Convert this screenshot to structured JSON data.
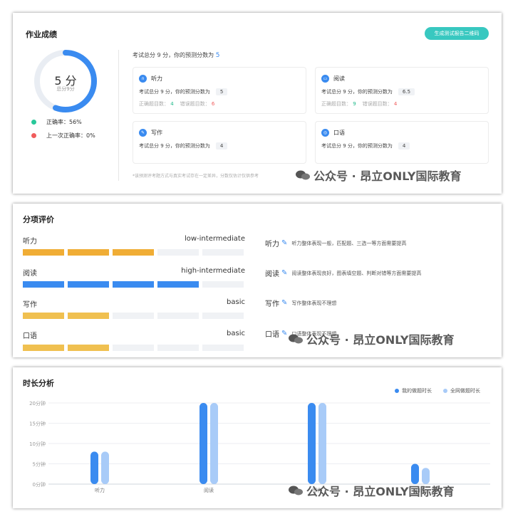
{
  "homework": {
    "title": "作业成绩",
    "generate_button": "生成测试报告二维码",
    "score_main": "5 分",
    "score_sub": "总分9分",
    "score_fraction": 0.556,
    "legend": [
      {
        "label": "正确率：",
        "value": "56%",
        "color": "#28c89a"
      },
      {
        "label": "上一次正确率：",
        "value": "0%",
        "color": "#f05c5c"
      }
    ],
    "summary_text": "考试总分 9 分，你的预测分数为",
    "summary_value": "5",
    "skills": [
      {
        "name": "听力",
        "icon": "headphones-icon",
        "glyph": "∩",
        "line": "考试总分 9 分，你的预测分数为",
        "score": "5",
        "correct_label": "正确题目数：",
        "correct": "4",
        "wrong_label": "错误题目数：",
        "wrong": "6"
      },
      {
        "name": "阅读",
        "icon": "book-icon",
        "glyph": "▭",
        "line": "考试总分 9 分，你的预测分数为",
        "score": "6.5",
        "correct_label": "正确题目数：",
        "correct": "9",
        "wrong_label": "错误题目数：",
        "wrong": "4"
      },
      {
        "name": "写作",
        "icon": "pencil-icon",
        "glyph": "✎",
        "line": "考试总分 9 分，你的预测分数为",
        "score": "4"
      },
      {
        "name": "口语",
        "icon": "speech-icon",
        "glyph": "◎",
        "line": "考试总分 9 分，你的预测分数为",
        "score": "4"
      }
    ],
    "footnote": "*该预测评考题方式与真实考试存在一定差异，分数仅估计仅供参考"
  },
  "evaluation": {
    "title": "分项评价",
    "items": [
      {
        "name": "听力",
        "level": "low-intermediate",
        "filled": 3,
        "color": "#f0ad35",
        "comment": "听力整体表现一般，匹配题、三选一等方面需要提高"
      },
      {
        "name": "阅读",
        "level": "high-intermediate",
        "filled": 4,
        "color": "#3a8bf0",
        "comment": "阅读整体表现良好，图表填空题、判断对错等方面需要提高"
      },
      {
        "name": "写作",
        "level": "basic",
        "filled": 2,
        "color": "#f0c050",
        "comment": "写作整体表现不理想"
      },
      {
        "name": "口语",
        "level": "basic",
        "filled": 2,
        "color": "#f0c050",
        "comment": "口语整体表现不理想"
      }
    ]
  },
  "duration": {
    "title": "时长分析",
    "chart_data": {
      "type": "bar",
      "categories": [
        "听力",
        "阅读",
        "写作",
        "口语"
      ],
      "series": [
        {
          "name": "我的做题时长",
          "color": "#3a8bf0",
          "values": [
            8,
            20,
            20,
            5
          ]
        },
        {
          "name": "全网做题时长",
          "color": "#a8cbf8",
          "values": [
            8,
            20,
            20,
            4
          ]
        }
      ],
      "ylim": [
        0,
        20
      ],
      "yticks": [
        "0分钟",
        "5分钟",
        "10分钟",
        "15分钟",
        "20分钟"
      ],
      "ytick_values": [
        0,
        5,
        10,
        15,
        20
      ],
      "grid": true,
      "legend": "top-right"
    }
  },
  "watermark": "公众号 · 昂立ONLY国际教育"
}
